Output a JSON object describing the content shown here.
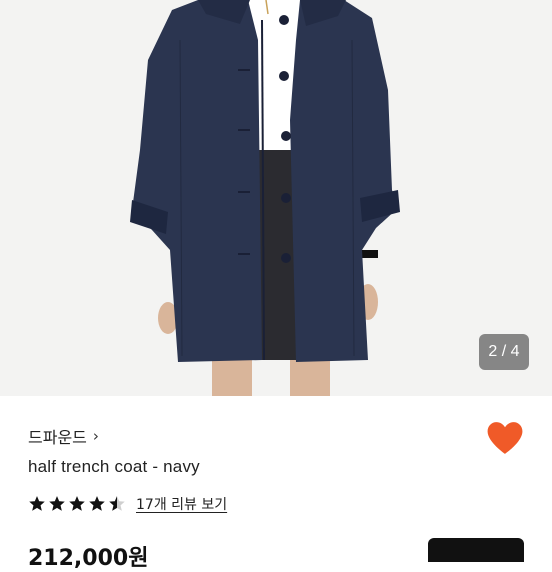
{
  "gallery": {
    "counter": "2 / 4"
  },
  "product": {
    "brand": "드파운드",
    "brand_chevron": "›",
    "title": "half trench coat - navy",
    "rating": 4.5,
    "reviews_link": "17개 리뷰 보기",
    "price_partial": "212,000원"
  },
  "colors": {
    "accent": "#f05a28",
    "coat": "#2b3550",
    "text": "#222222"
  },
  "icons": {
    "favorite": "heart-icon",
    "star": "star-icon",
    "chevron": "chevron-right-icon"
  }
}
